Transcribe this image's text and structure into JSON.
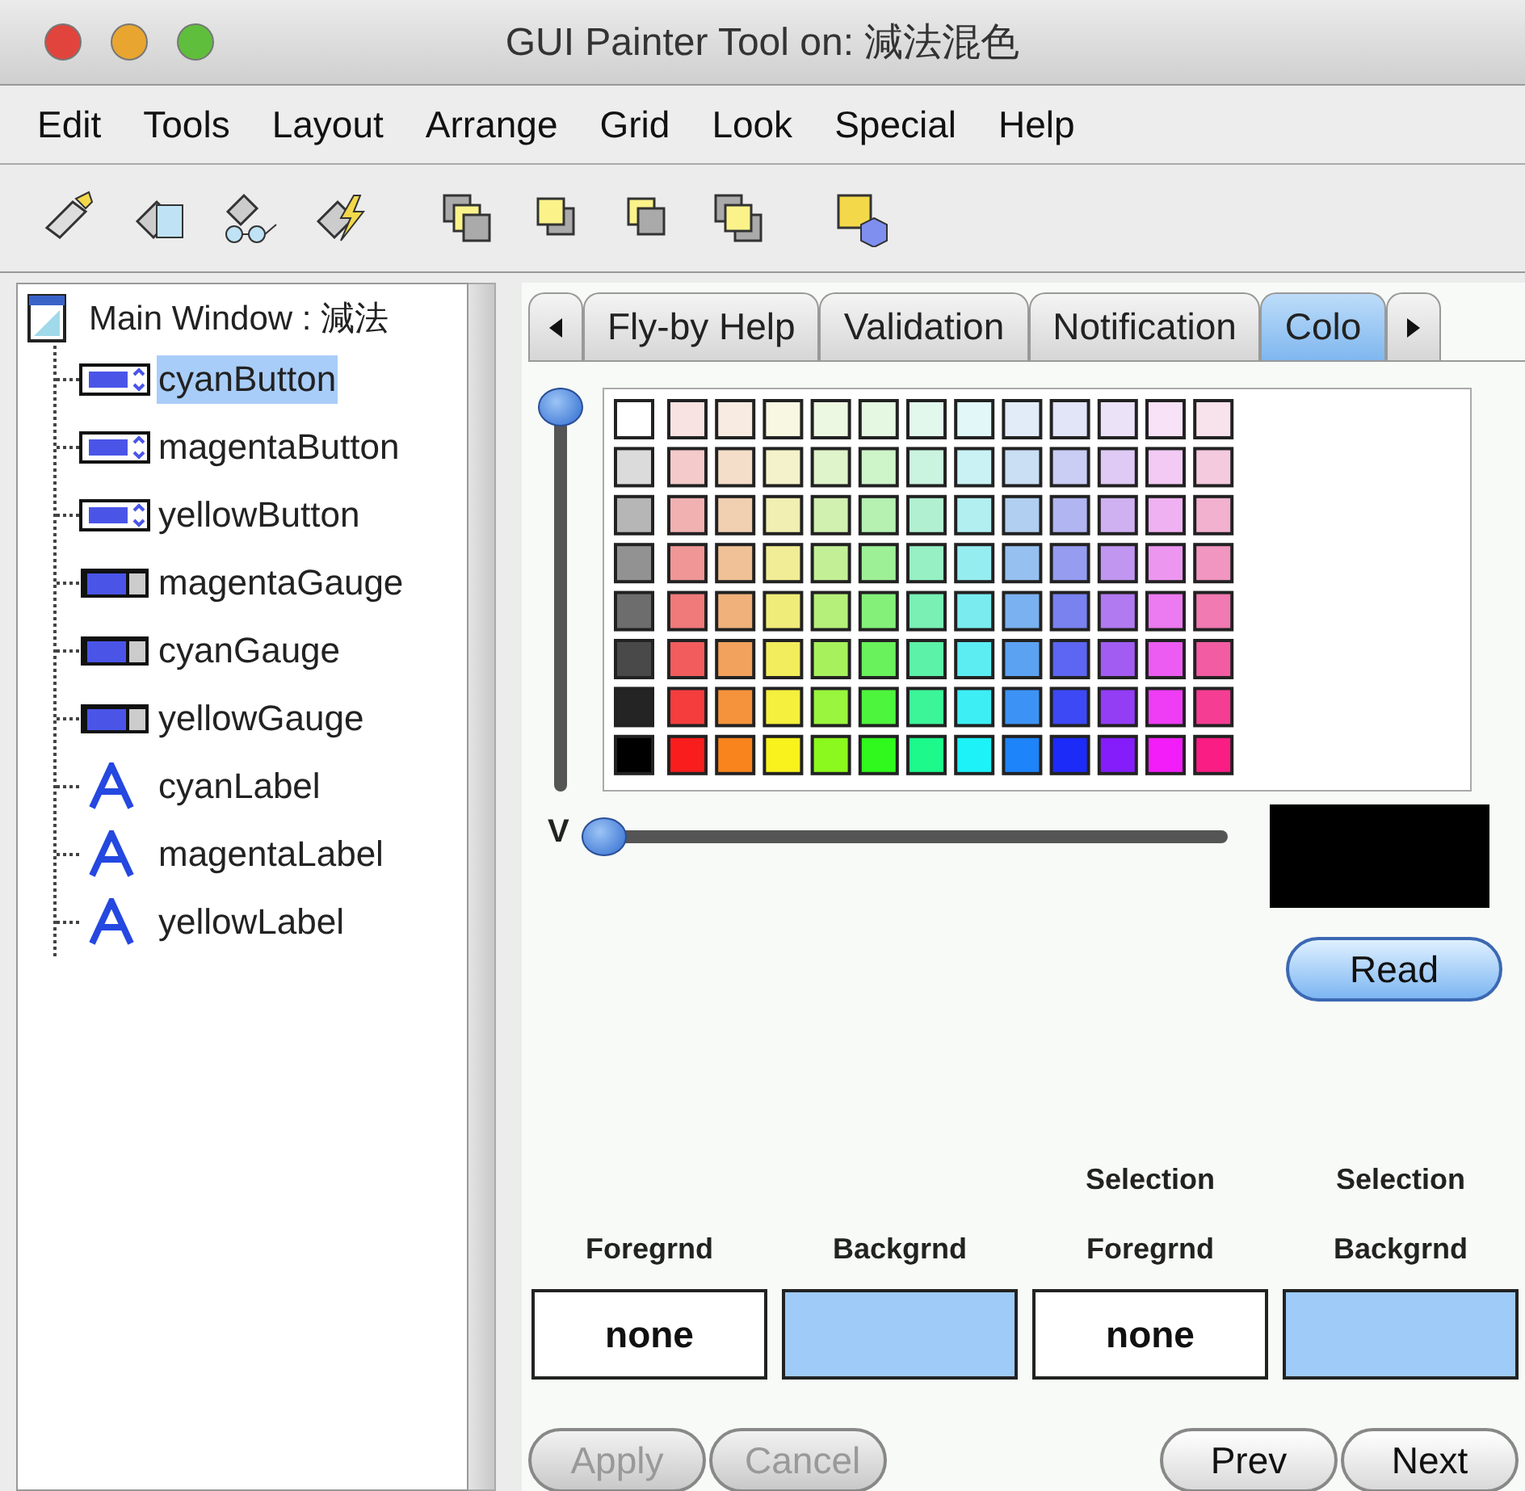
{
  "window": {
    "title": "GUI Painter Tool on: 減法混色"
  },
  "menu": [
    "Edit",
    "Tools",
    "Layout",
    "Arrange",
    "Grid",
    "Look",
    "Special",
    "Help"
  ],
  "toolbar": [
    {
      "kind": "pencil"
    },
    {
      "kind": "define"
    },
    {
      "kind": "browse"
    },
    {
      "kind": "lightning"
    },
    {
      "kind": "front"
    },
    {
      "kind": "back"
    },
    {
      "kind": "forward"
    },
    {
      "kind": "backward"
    },
    {
      "kind": "palette"
    }
  ],
  "tree": {
    "label": "Main Window : 減法",
    "children": [
      {
        "label": "cyanButton",
        "kind": "button",
        "selected": true
      },
      {
        "label": "magentaButton",
        "kind": "button",
        "selected": false
      },
      {
        "label": "yellowButton",
        "kind": "button",
        "selected": false
      },
      {
        "label": "magentaGauge",
        "kind": "gauge",
        "selected": false
      },
      {
        "label": "cyanGauge",
        "kind": "gauge",
        "selected": false
      },
      {
        "label": "yellowGauge",
        "kind": "gauge",
        "selected": false
      },
      {
        "label": "cyanLabel",
        "kind": "label",
        "selected": false
      },
      {
        "label": "magentaLabel",
        "kind": "label",
        "selected": false
      },
      {
        "label": "yellowLabel",
        "kind": "label",
        "selected": false
      }
    ]
  },
  "tabs": [
    {
      "label": "Fly-by Help",
      "selected": false
    },
    {
      "label": "Validation",
      "selected": false
    },
    {
      "label": "Notification",
      "selected": false
    },
    {
      "label": "Colo",
      "selected": true
    }
  ],
  "saturation_slider": {
    "level": 1
  },
  "value_slider": {
    "label": "V",
    "level": 0
  },
  "preview": {
    "color": "#000000"
  },
  "read_button": "Read",
  "color_slots": [
    {
      "heading": [
        "Foregrnd"
      ],
      "value": "none",
      "color": "#ffffff"
    },
    {
      "heading": [
        "Backgrnd"
      ],
      "color": "#9ecbf8"
    },
    {
      "heading": [
        "Selection",
        "Foregrnd"
      ],
      "value": "none",
      "color": "#ffffff"
    },
    {
      "heading": [
        "Selection",
        "Backgrnd"
      ],
      "color": "#9ecbf8"
    }
  ],
  "buttons": [
    {
      "label": "Apply",
      "disabled": true
    },
    {
      "label": "Cancel",
      "disabled": true
    },
    {
      "label": "Prev",
      "disabled": false
    },
    {
      "label": "Next",
      "disabled": false
    }
  ]
}
